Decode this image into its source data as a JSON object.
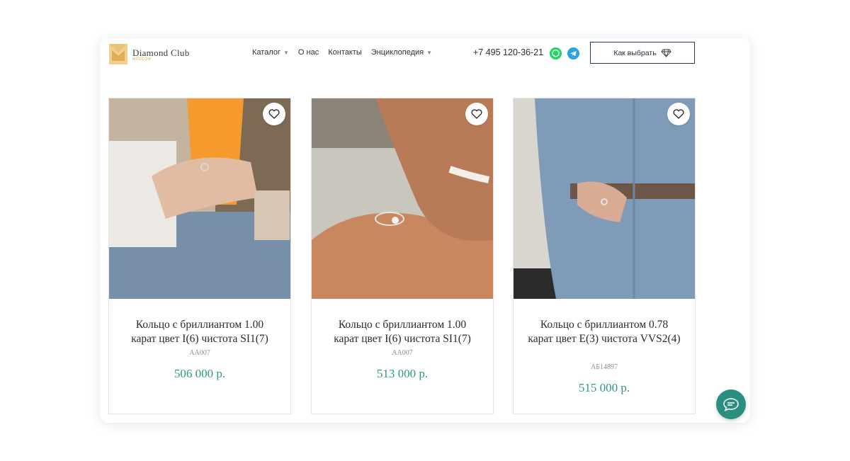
{
  "header": {
    "logo_text": "Diamond Club",
    "logo_sub": "MOSCOW",
    "nav": [
      {
        "label": "Каталог",
        "caret": "▼"
      },
      {
        "label": "О нас"
      },
      {
        "label": "Контакты"
      },
      {
        "label": "Энциклопедия",
        "caret": "▼"
      }
    ],
    "phone": "+7 495 120-36-21",
    "choose_button": "Как выбрать",
    "icons": [
      "whatsapp-icon",
      "telegram-icon",
      "diamond-icon"
    ]
  },
  "products": [
    {
      "title": "Кольцо с бриллиантом 1.00 карат цвет I(6) чистота SI1(7)",
      "sku": "АА007",
      "price": "506 000 р."
    },
    {
      "title": "Кольцо с бриллиантом 1.00 карат цвет I(6) чистота SI1(7)",
      "sku": "АА007",
      "price": "513 000 р."
    },
    {
      "title": "Кольцо с бриллиантом 0.78 карат цвет E(3) чистота VVS2(4)",
      "sku": "АБ14897",
      "price": "515 000 р."
    }
  ],
  "colors": {
    "price": "#2a9a86",
    "chat": "#2a8f7f",
    "whatsapp": "#25d366",
    "telegram": "#2aa3df",
    "logo_gold": "#d2a74a"
  }
}
